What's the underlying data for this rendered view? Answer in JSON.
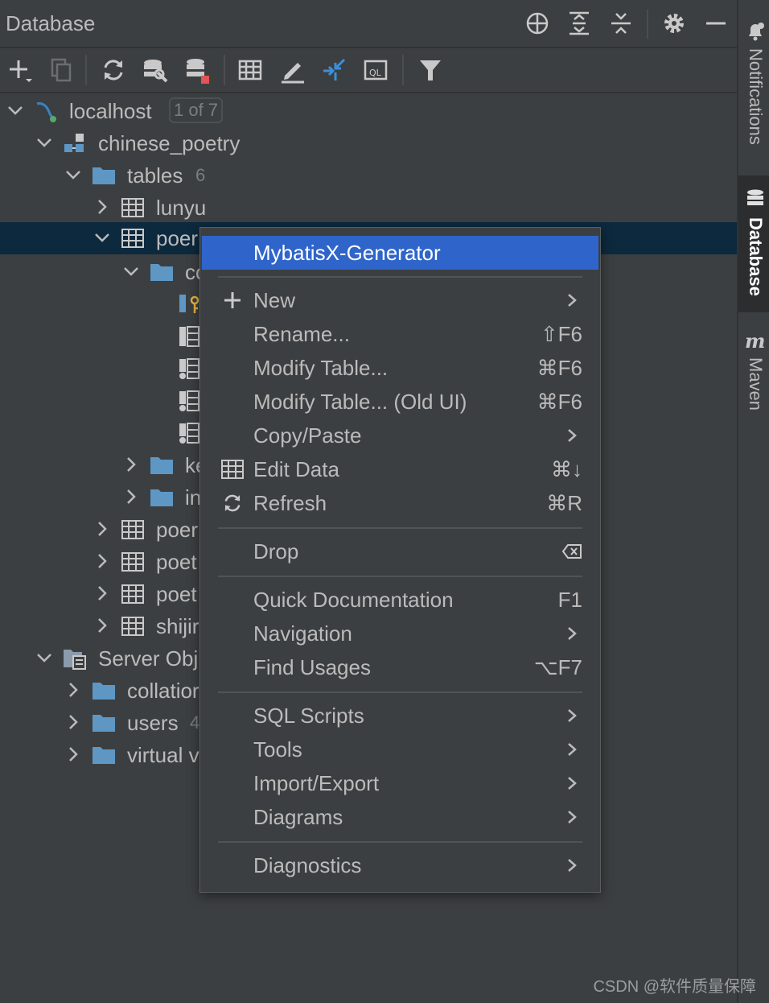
{
  "header": {
    "title": "Database",
    "icons": [
      "target-icon",
      "expand-all-icon",
      "collapse-all-icon",
      "gear-icon",
      "minimize-icon"
    ]
  },
  "toolbar": {
    "icons": [
      "add-icon",
      "duplicate-icon",
      "refresh-icon",
      "data-source-properties-icon",
      "stop-icon",
      "table-icon",
      "edit-icon",
      "jump-icon",
      "query-console-icon",
      "filter-icon"
    ]
  },
  "tree": {
    "rows": [
      {
        "label": "localhost",
        "badge": "1 of 7",
        "icon": "mysql-icon"
      },
      {
        "label": "chinese_poetry",
        "icon": "schema-icon"
      },
      {
        "label": "tables",
        "count": "6",
        "icon": "folder-icon"
      },
      {
        "label": "lunyu",
        "icon": "table-icon"
      },
      {
        "label": "poer",
        "icon": "table-icon"
      },
      {
        "label": "co",
        "icon": "folder-icon"
      },
      {
        "label": "",
        "icon": "primary-key-column-icon"
      },
      {
        "label": "",
        "icon": "column-icon"
      },
      {
        "label": "",
        "icon": "column-icon"
      },
      {
        "label": "",
        "icon": "column-icon"
      },
      {
        "label": "",
        "icon": "column-icon"
      },
      {
        "label": "ke",
        "icon": "folder-icon"
      },
      {
        "label": "in",
        "icon": "folder-icon"
      },
      {
        "label": "poer",
        "icon": "table-icon"
      },
      {
        "label": "poet",
        "icon": "table-icon"
      },
      {
        "label": "poet",
        "icon": "table-icon"
      },
      {
        "label": "shijir",
        "icon": "table-icon"
      },
      {
        "label": "Server Obj",
        "icon": "server-objects-icon"
      },
      {
        "label": "collatior",
        "icon": "folder-icon"
      },
      {
        "label": "users",
        "count": "4",
        "icon": "folder-icon"
      },
      {
        "label": "virtual v",
        "icon": "folder-icon"
      }
    ]
  },
  "context_menu": {
    "items": [
      {
        "label": "MybatisX-Generator",
        "highlighted": true
      },
      {
        "label": "New",
        "icon": "plus-icon",
        "submenu": true
      },
      {
        "label": "Rename...",
        "shortcut": "⇧F6"
      },
      {
        "label": "Modify Table...",
        "shortcut": "⌘F6"
      },
      {
        "label": "Modify Table... (Old UI)",
        "shortcut": "⌘F6"
      },
      {
        "label": "Copy/Paste",
        "submenu": true
      },
      {
        "label": "Edit Data",
        "icon": "table-icon",
        "shortcut": "⌘↓"
      },
      {
        "label": "Refresh",
        "icon": "refresh-icon",
        "shortcut": "⌘R"
      },
      {
        "label": "Drop",
        "shortcut_icon": "delete-key-icon"
      },
      {
        "label": "Quick Documentation",
        "shortcut": "F1"
      },
      {
        "label": "Navigation",
        "submenu": true
      },
      {
        "label": "Find Usages",
        "shortcut": "⌥F7"
      },
      {
        "label": "SQL Scripts",
        "submenu": true
      },
      {
        "label": "Tools",
        "submenu": true
      },
      {
        "label": "Import/Export",
        "submenu": true
      },
      {
        "label": "Diagrams",
        "submenu": true
      },
      {
        "label": "Diagnostics",
        "submenu": true
      }
    ]
  },
  "right_stripe": {
    "tabs": [
      {
        "label": "Notifications",
        "icon": "bell-icon"
      },
      {
        "label": "Database",
        "icon": "database-icon",
        "active": true
      },
      {
        "label": "Maven",
        "icon": "maven-icon"
      }
    ]
  },
  "watermark": "CSDN @软件质量保障",
  "colors": {
    "background": "#3c3f41",
    "selection": "#0d293e",
    "menu_highlight": "#2f65ca",
    "folder": "#5e97c4",
    "text": "#bbbbbb"
  }
}
